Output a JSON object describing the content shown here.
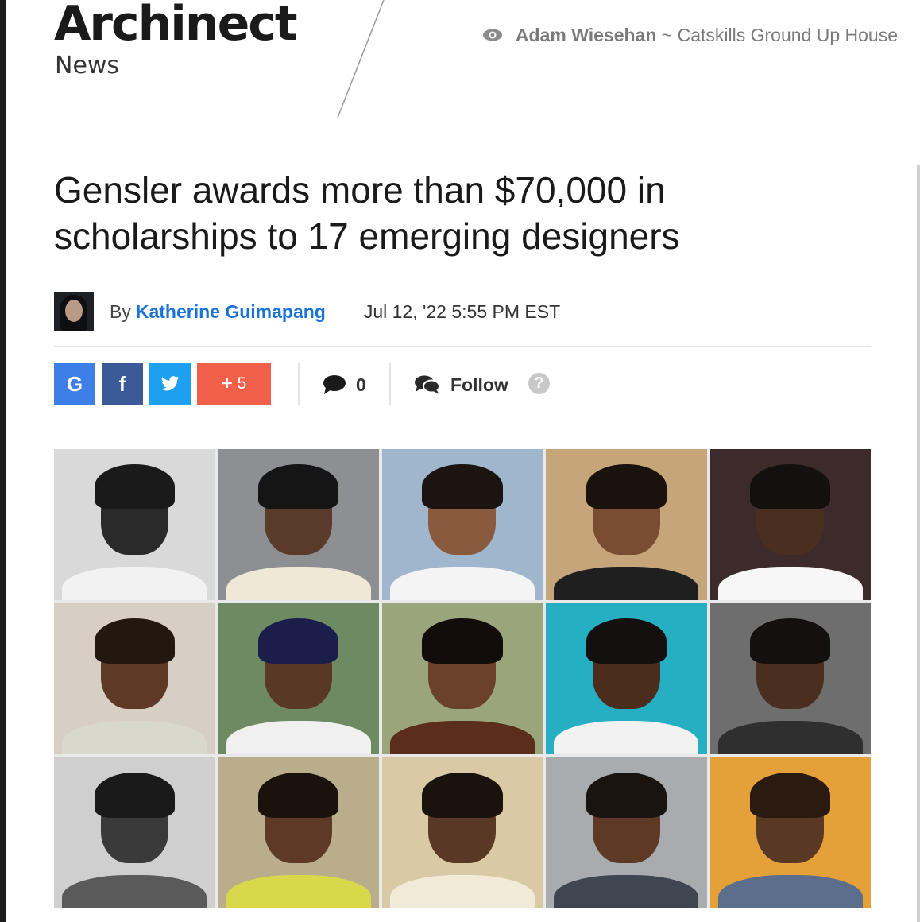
{
  "site": {
    "logo": "Archinect",
    "section": "News"
  },
  "featured_link": {
    "author": "Adam Wiesehan",
    "separator": "~",
    "title": "Catskills Ground Up House",
    "icon": "eye-icon"
  },
  "article": {
    "headline": "Gensler awards more than $70,000 in scholarships to 17 emerging designers",
    "byline_prefix": "By",
    "author": "Katherine Guimapang",
    "date": "Jul 12, '22 5:55 PM EST"
  },
  "share": {
    "google_label": "G",
    "facebook_label": "f",
    "more_plus": "+",
    "more_count": "5",
    "comments_count": "0",
    "follow_label": "Follow",
    "help_label": "?"
  },
  "colors": {
    "google": "#3d7fe6",
    "facebook": "#3b5b98",
    "twitter": "#1ea0f0",
    "more": "#f0604a",
    "author_link": "#1a73d8"
  },
  "collage": {
    "rows": 3,
    "columns": 5,
    "tiles": [
      {
        "bg": "#d9d9d9",
        "skin": "#2a2a2a",
        "hair": "#1a1a1a",
        "top": "#f2f2f2"
      },
      {
        "bg": "#8e8f93",
        "skin": "#5a3a28",
        "hair": "#151515",
        "top": "#efe8d6"
      },
      {
        "bg": "#9fb6cc",
        "skin": "#8a5a3e",
        "hair": "#1c1410",
        "top": "#f4f4f4"
      },
      {
        "bg": "#c7a57a",
        "skin": "#7a4c32",
        "hair": "#1a120d",
        "top": "#1f1f1f"
      },
      {
        "bg": "#3d2a2a",
        "skin": "#4a2e1f",
        "hair": "#141010",
        "top": "#f7f7f7"
      },
      {
        "bg": "#d8cfc4",
        "skin": "#5e3a26",
        "hair": "#221810",
        "top": "#d8d8cc"
      },
      {
        "bg": "#6d8a62",
        "skin": "#5a3826",
        "hair": "#1b1d4a",
        "top": "#f0f0f0"
      },
      {
        "bg": "#9aa57c",
        "skin": "#6a412b",
        "hair": "#120d0a",
        "top": "#5a2e1a"
      },
      {
        "bg": "#26aec2",
        "skin": "#4a2d1c",
        "hair": "#151010",
        "top": "#f2f2f2"
      },
      {
        "bg": "#6e6e6e",
        "skin": "#4a2f20",
        "hair": "#141010",
        "top": "#2f2f2f"
      },
      {
        "bg": "#cfcfcf",
        "skin": "#3a3a3a",
        "hair": "#1a1a1a",
        "top": "#5a5a5a"
      },
      {
        "bg": "#b9ad8c",
        "skin": "#5e3a26",
        "hair": "#1a120d",
        "top": "#d9d84a"
      },
      {
        "bg": "#d9c9a4",
        "skin": "#5a3826",
        "hair": "#1a120d",
        "top": "#f1ead8"
      },
      {
        "bg": "#a9acaf",
        "skin": "#5e3a26",
        "hair": "#1a1410",
        "top": "#3f4652"
      },
      {
        "bg": "#e4a13a",
        "skin": "#5a3826",
        "hair": "#2a1a10",
        "top": "#5c6e8c"
      }
    ]
  }
}
